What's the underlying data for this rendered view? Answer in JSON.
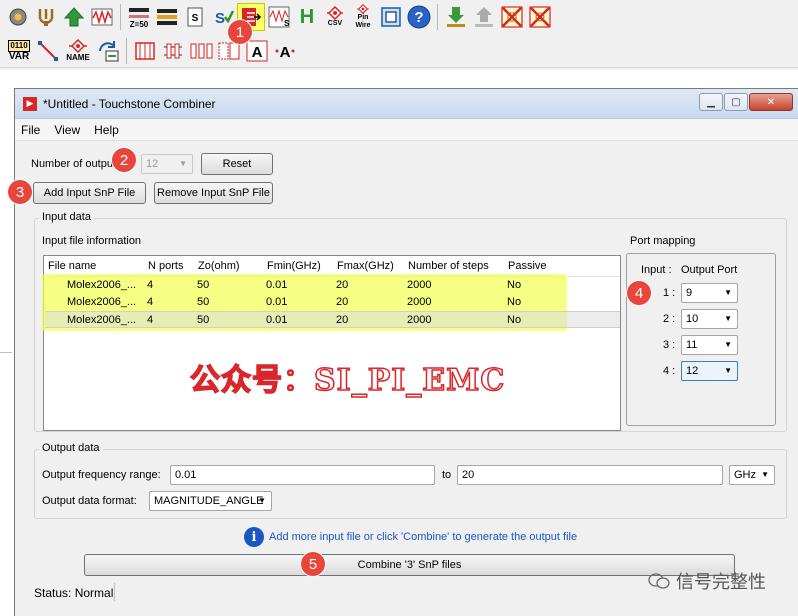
{
  "toolbar1": {
    "icons": [
      "gear-icon",
      "tuner-icon",
      "up-arrow-icon",
      "waveform-icon",
      "impedance-z50-icon",
      "filter-icon",
      "s-param-icon",
      "s-check-icon",
      "port-map-icon",
      "s-plot-icon",
      "h-icon",
      "csv-icon",
      "pin-wire-icon",
      "frame-icon",
      "help-icon",
      "download-icon",
      "upload-icon",
      "no-layout-icon",
      "no-net-icon"
    ],
    "z50_label": "Z=50",
    "csv_label": "CSV",
    "pin_wire_label": "Pin Wire",
    "h_label": "H"
  },
  "toolbar2": {
    "var_top": "0110",
    "var_label": "VAR",
    "name_label": "NAME"
  },
  "window": {
    "title": "*Untitled - Touchstone Combiner",
    "menu": [
      "File",
      "View",
      "Help"
    ]
  },
  "outputs": {
    "label": "Number of outputs:",
    "value": "12",
    "reset_label": "Reset"
  },
  "buttons": {
    "add_label": "Add Input SnP File",
    "remove_label": "Remove Input SnP File",
    "combine_label": "Combine '3' SnP files"
  },
  "input_data": {
    "group_title": "Input data",
    "info_title": "Input file information",
    "columns": [
      "File name",
      "N ports",
      "Zo(ohm)",
      "Fmin(GHz)",
      "Fmax(GHz)",
      "Number of steps",
      "Passive"
    ],
    "rows": [
      [
        "Molex2006_...",
        "4",
        "50",
        "0.01",
        "20",
        "2000",
        "No"
      ],
      [
        "Molex2006_...",
        "4",
        "50",
        "0.01",
        "20",
        "2000",
        "No"
      ],
      [
        "Molex2006_...",
        "4",
        "50",
        "0.01",
        "20",
        "2000",
        "No"
      ]
    ]
  },
  "port_mapping": {
    "title": "Port mapping",
    "input_header": "Input :",
    "output_header": "Output Port",
    "rows": [
      {
        "input": "1 :",
        "port": "9"
      },
      {
        "input": "2 :",
        "port": "10"
      },
      {
        "input": "3 :",
        "port": "11"
      },
      {
        "input": "4 :",
        "port": "12"
      }
    ]
  },
  "output_data": {
    "group_title": "Output data",
    "freq_label": "Output frequency range:",
    "freq_from": "0.01",
    "to_label": "to",
    "freq_to": "20",
    "unit": "GHz",
    "format_label": "Output data format:",
    "format_value": "MAGNITUDE_ANGLE"
  },
  "info_message": "Add more input file or click 'Combine' to generate the output file",
  "status_text": "Status: Normal",
  "callouts": [
    "1",
    "2",
    "3",
    "4",
    "5"
  ],
  "watermark": "公众号：SI_PI_EMC",
  "brand": "信号完整性",
  "colors": {
    "callout": "#e8453c",
    "highlight": "#f0ff50",
    "watermark_stroke": "#d9262a",
    "info_blue": "#1a56c4"
  }
}
